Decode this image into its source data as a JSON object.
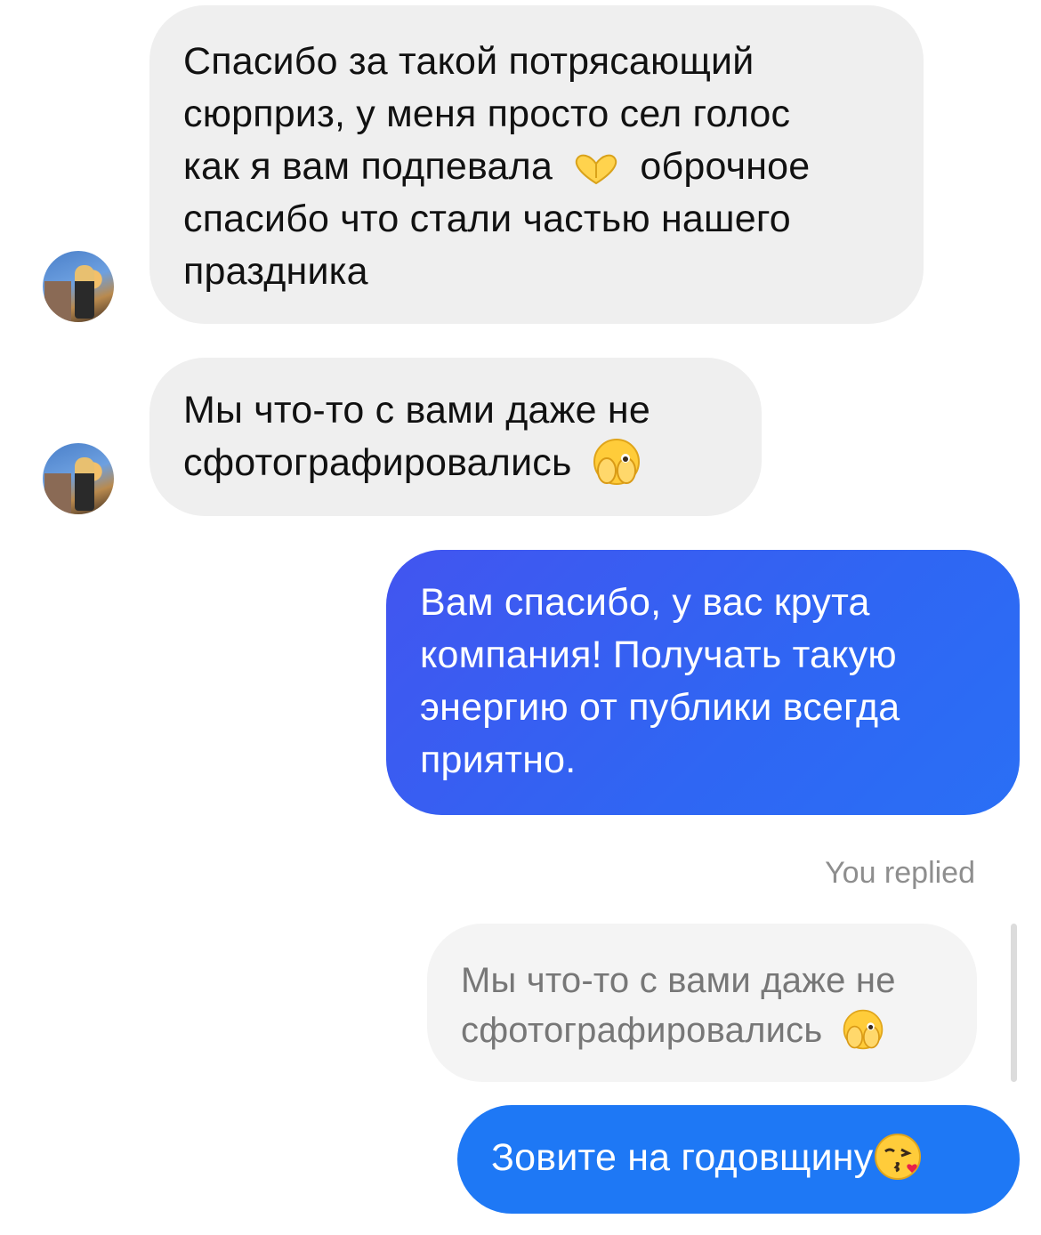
{
  "messages": [
    {
      "sender": "other",
      "line1": "Спасибо за такой потрясающий",
      "line2": "сюрприз, у меня просто сел голос",
      "line3_pre": "как я вам подпевала",
      "line3_post": "оброчное",
      "line4": "спасибо что стали частью нашего",
      "line5": "праздника",
      "emoji": "heart-hands"
    },
    {
      "sender": "other",
      "line1": "Мы что-то с вами даже не",
      "line2": "сфотографировались",
      "emoji": "face-peeking-eye"
    },
    {
      "sender": "me",
      "line1": "Вам спасибо, у вас крута",
      "line2": "компания! Получать такую",
      "line3": "энергию от публики всегда",
      "line4": "приятно."
    }
  ],
  "reply": {
    "label": "You replied",
    "quoted_line1": "Мы что-то с вами даже не",
    "quoted_line2": "сфотографировались",
    "quoted_emoji": "face-peeking-eye",
    "text": "Зовите на годовщину",
    "emoji": "face-blowing-kiss"
  },
  "colors": {
    "incoming_bg": "#efefef",
    "outgoing_gradient_start": "#3a5cf0",
    "outgoing_gradient_end": "#2a6cf5",
    "reply_bubble": "#1e78f5"
  }
}
